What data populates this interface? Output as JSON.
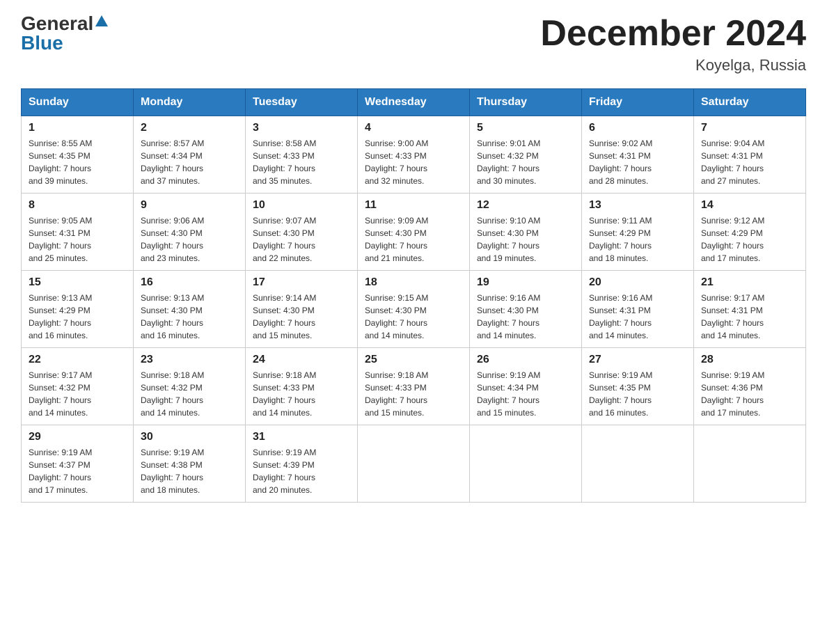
{
  "header": {
    "logo_general": "General",
    "logo_blue": "Blue",
    "title": "December 2024",
    "subtitle": "Koyelga, Russia"
  },
  "days_of_week": [
    "Sunday",
    "Monday",
    "Tuesday",
    "Wednesday",
    "Thursday",
    "Friday",
    "Saturday"
  ],
  "weeks": [
    [
      {
        "day": "1",
        "sunrise": "8:55 AM",
        "sunset": "4:35 PM",
        "daylight": "7 hours and 39 minutes."
      },
      {
        "day": "2",
        "sunrise": "8:57 AM",
        "sunset": "4:34 PM",
        "daylight": "7 hours and 37 minutes."
      },
      {
        "day": "3",
        "sunrise": "8:58 AM",
        "sunset": "4:33 PM",
        "daylight": "7 hours and 35 minutes."
      },
      {
        "day": "4",
        "sunrise": "9:00 AM",
        "sunset": "4:33 PM",
        "daylight": "7 hours and 32 minutes."
      },
      {
        "day": "5",
        "sunrise": "9:01 AM",
        "sunset": "4:32 PM",
        "daylight": "7 hours and 30 minutes."
      },
      {
        "day": "6",
        "sunrise": "9:02 AM",
        "sunset": "4:31 PM",
        "daylight": "7 hours and 28 minutes."
      },
      {
        "day": "7",
        "sunrise": "9:04 AM",
        "sunset": "4:31 PM",
        "daylight": "7 hours and 27 minutes."
      }
    ],
    [
      {
        "day": "8",
        "sunrise": "9:05 AM",
        "sunset": "4:31 PM",
        "daylight": "7 hours and 25 minutes."
      },
      {
        "day": "9",
        "sunrise": "9:06 AM",
        "sunset": "4:30 PM",
        "daylight": "7 hours and 23 minutes."
      },
      {
        "day": "10",
        "sunrise": "9:07 AM",
        "sunset": "4:30 PM",
        "daylight": "7 hours and 22 minutes."
      },
      {
        "day": "11",
        "sunrise": "9:09 AM",
        "sunset": "4:30 PM",
        "daylight": "7 hours and 21 minutes."
      },
      {
        "day": "12",
        "sunrise": "9:10 AM",
        "sunset": "4:30 PM",
        "daylight": "7 hours and 19 minutes."
      },
      {
        "day": "13",
        "sunrise": "9:11 AM",
        "sunset": "4:29 PM",
        "daylight": "7 hours and 18 minutes."
      },
      {
        "day": "14",
        "sunrise": "9:12 AM",
        "sunset": "4:29 PM",
        "daylight": "7 hours and 17 minutes."
      }
    ],
    [
      {
        "day": "15",
        "sunrise": "9:13 AM",
        "sunset": "4:29 PM",
        "daylight": "7 hours and 16 minutes."
      },
      {
        "day": "16",
        "sunrise": "9:13 AM",
        "sunset": "4:30 PM",
        "daylight": "7 hours and 16 minutes."
      },
      {
        "day": "17",
        "sunrise": "9:14 AM",
        "sunset": "4:30 PM",
        "daylight": "7 hours and 15 minutes."
      },
      {
        "day": "18",
        "sunrise": "9:15 AM",
        "sunset": "4:30 PM",
        "daylight": "7 hours and 14 minutes."
      },
      {
        "day": "19",
        "sunrise": "9:16 AM",
        "sunset": "4:30 PM",
        "daylight": "7 hours and 14 minutes."
      },
      {
        "day": "20",
        "sunrise": "9:16 AM",
        "sunset": "4:31 PM",
        "daylight": "7 hours and 14 minutes."
      },
      {
        "day": "21",
        "sunrise": "9:17 AM",
        "sunset": "4:31 PM",
        "daylight": "7 hours and 14 minutes."
      }
    ],
    [
      {
        "day": "22",
        "sunrise": "9:17 AM",
        "sunset": "4:32 PM",
        "daylight": "7 hours and 14 minutes."
      },
      {
        "day": "23",
        "sunrise": "9:18 AM",
        "sunset": "4:32 PM",
        "daylight": "7 hours and 14 minutes."
      },
      {
        "day": "24",
        "sunrise": "9:18 AM",
        "sunset": "4:33 PM",
        "daylight": "7 hours and 14 minutes."
      },
      {
        "day": "25",
        "sunrise": "9:18 AM",
        "sunset": "4:33 PM",
        "daylight": "7 hours and 15 minutes."
      },
      {
        "day": "26",
        "sunrise": "9:19 AM",
        "sunset": "4:34 PM",
        "daylight": "7 hours and 15 minutes."
      },
      {
        "day": "27",
        "sunrise": "9:19 AM",
        "sunset": "4:35 PM",
        "daylight": "7 hours and 16 minutes."
      },
      {
        "day": "28",
        "sunrise": "9:19 AM",
        "sunset": "4:36 PM",
        "daylight": "7 hours and 17 minutes."
      }
    ],
    [
      {
        "day": "29",
        "sunrise": "9:19 AM",
        "sunset": "4:37 PM",
        "daylight": "7 hours and 17 minutes."
      },
      {
        "day": "30",
        "sunrise": "9:19 AM",
        "sunset": "4:38 PM",
        "daylight": "7 hours and 18 minutes."
      },
      {
        "day": "31",
        "sunrise": "9:19 AM",
        "sunset": "4:39 PM",
        "daylight": "7 hours and 20 minutes."
      },
      null,
      null,
      null,
      null
    ]
  ]
}
